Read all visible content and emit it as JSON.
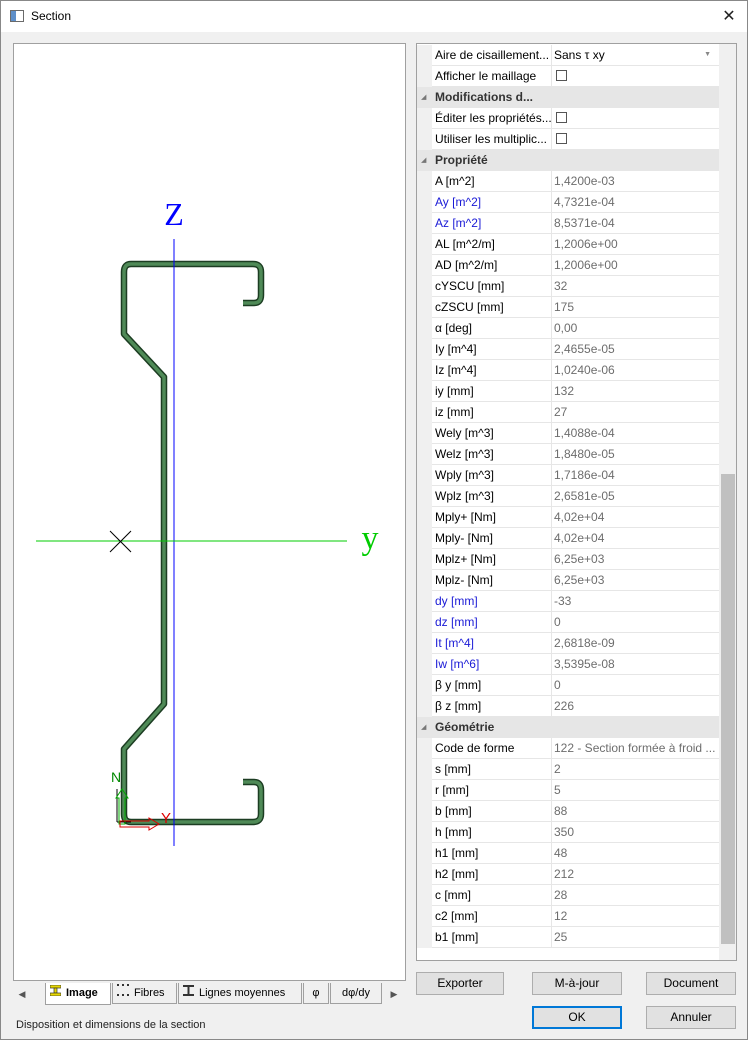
{
  "window": {
    "title": "Section"
  },
  "canvas": {
    "z_label": "Z",
    "y_label": "y",
    "local_n": "N",
    "local_y": "Y"
  },
  "tabs": [
    {
      "label": "Image",
      "icon": "i-beam-yellow-icon",
      "active": true
    },
    {
      "label": "Fibres",
      "icon": "fibres-icon"
    },
    {
      "label": "Lignes moyennes",
      "icon": "i-beam-icon"
    },
    {
      "label": "φ"
    },
    {
      "label": "dφ/dy"
    }
  ],
  "status": "Disposition et dimensions de la section",
  "properties": {
    "top_rows": [
      {
        "name": "Aire de cisaillement...",
        "value": "Sans τ xy",
        "type": "dropdown"
      },
      {
        "name": "Afficher le maillage",
        "type": "checkbox"
      }
    ],
    "categories": [
      {
        "title": "Modifications d...",
        "rows": [
          {
            "name": "Éditer les propriétés...",
            "type": "checkbox"
          },
          {
            "name": "Utiliser les multiplic...",
            "type": "checkbox"
          }
        ]
      },
      {
        "title": "Propriété",
        "rows": [
          {
            "name": "A [m^2]",
            "value": "1,4200e-03"
          },
          {
            "name": "Ay [m^2]",
            "value": "4,7321e-04",
            "blue": true
          },
          {
            "name": "Az [m^2]",
            "value": "8,5371e-04",
            "blue": true
          },
          {
            "name": "AL [m^2/m]",
            "value": "1,2006e+00"
          },
          {
            "name": "AD [m^2/m]",
            "value": "1,2006e+00"
          },
          {
            "name": "cYSCU [mm]",
            "value": "32"
          },
          {
            "name": "cZSCU [mm]",
            "value": "175"
          },
          {
            "name": "α [deg]",
            "value": "0,00"
          },
          {
            "name": "Iy [m^4]",
            "value": "2,4655e-05"
          },
          {
            "name": "Iz [m^4]",
            "value": "1,0240e-06"
          },
          {
            "name": "iy [mm]",
            "value": "132"
          },
          {
            "name": "iz [mm]",
            "value": "27"
          },
          {
            "name": "Wely [m^3]",
            "value": "1,4088e-04"
          },
          {
            "name": "Welz [m^3]",
            "value": "1,8480e-05"
          },
          {
            "name": "Wply [m^3]",
            "value": "1,7186e-04"
          },
          {
            "name": "Wplz [m^3]",
            "value": "2,6581e-05"
          },
          {
            "name": "Mply+ [Nm]",
            "value": "4,02e+04"
          },
          {
            "name": "Mply- [Nm]",
            "value": "4,02e+04"
          },
          {
            "name": "Mplz+ [Nm]",
            "value": "6,25e+03"
          },
          {
            "name": "Mplz- [Nm]",
            "value": "6,25e+03"
          },
          {
            "name": "dy [mm]",
            "value": "-33",
            "blue": true
          },
          {
            "name": "dz [mm]",
            "value": "0",
            "blue": true
          },
          {
            "name": "It [m^4]",
            "value": "2,6818e-09",
            "blue": true
          },
          {
            "name": "Iw [m^6]",
            "value": "3,5395e-08",
            "blue": true
          },
          {
            "name": "β y [mm]",
            "value": "0"
          },
          {
            "name": "β z [mm]",
            "value": "226"
          }
        ]
      },
      {
        "title": "Géométrie",
        "rows": [
          {
            "name": "Code de forme",
            "value": "122 - Section formée à froid ..."
          },
          {
            "name": "s [mm]",
            "value": "2"
          },
          {
            "name": "r [mm]",
            "value": "5"
          },
          {
            "name": "b [mm]",
            "value": "88"
          },
          {
            "name": "h [mm]",
            "value": "350"
          },
          {
            "name": "h1 [mm]",
            "value": "48"
          },
          {
            "name": "h2 [mm]",
            "value": "212"
          },
          {
            "name": "c [mm]",
            "value": "28"
          },
          {
            "name": "c2 [mm]",
            "value": "12"
          },
          {
            "name": "b1 [mm]",
            "value": "25"
          }
        ]
      }
    ]
  },
  "buttons": {
    "export": "Exporter",
    "update": "M-à-jour",
    "document": "Document",
    "ok": "OK",
    "cancel": "Annuler"
  },
  "colors": {
    "profile": "#2e6b3a",
    "z_axis": "#0000ff",
    "y_axis": "#00cc00",
    "label_blue": "#1a1ad6"
  }
}
